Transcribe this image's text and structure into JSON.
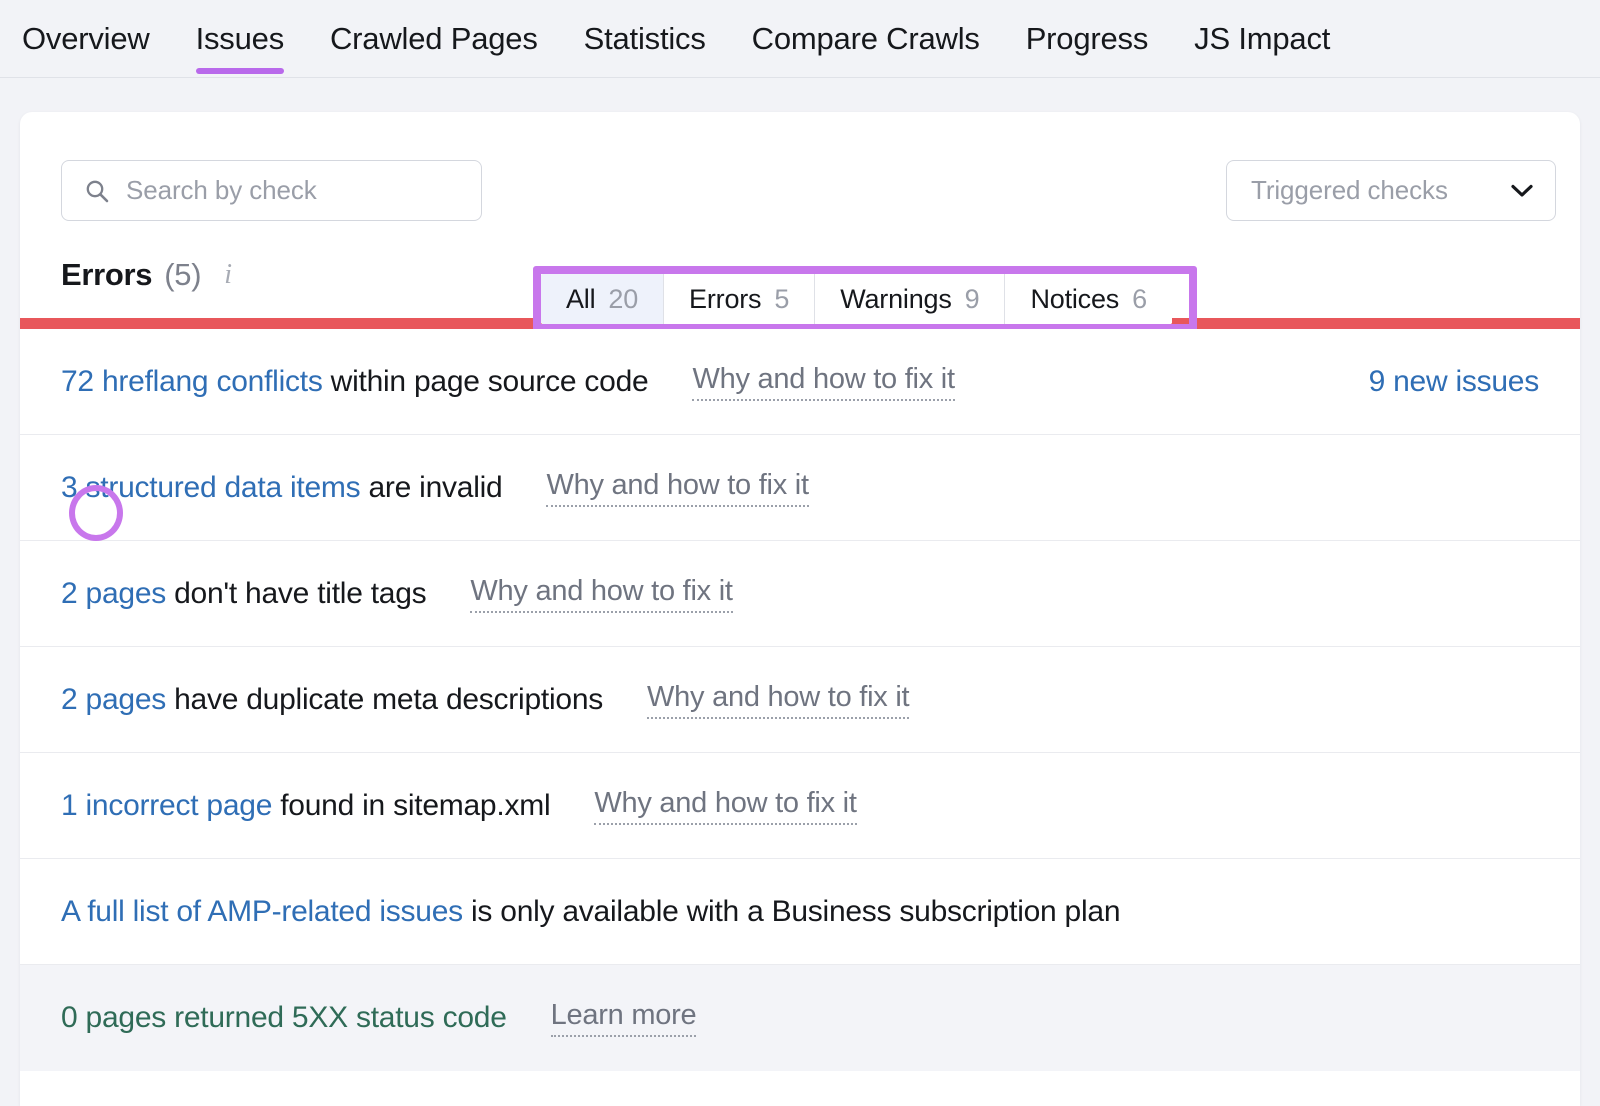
{
  "tabs": [
    {
      "label": "Overview",
      "active": false
    },
    {
      "label": "Issues",
      "active": true
    },
    {
      "label": "Crawled Pages",
      "active": false
    },
    {
      "label": "Statistics",
      "active": false
    },
    {
      "label": "Compare Crawls",
      "active": false
    },
    {
      "label": "Progress",
      "active": false
    },
    {
      "label": "JS Impact",
      "active": false
    }
  ],
  "toolbar": {
    "search_placeholder": "Search by check",
    "search_value": "",
    "segments": [
      {
        "label": "All",
        "count": "20",
        "selected": true
      },
      {
        "label": "Errors",
        "count": "5",
        "selected": false
      },
      {
        "label": "Warnings",
        "count": "9",
        "selected": false
      },
      {
        "label": "Notices",
        "count": "6",
        "selected": false
      }
    ],
    "dropdown_label": "Triggered checks"
  },
  "section": {
    "title": "Errors",
    "count": "(5)",
    "info_icon": "info-icon",
    "severity_color": "#e8575b"
  },
  "issues": [
    {
      "link_text": "72 hreflang conflicts",
      "rest_text": " within page source code",
      "fix_link": "Why and how to fix it",
      "new_issues": "9 new issues",
      "muted": false
    },
    {
      "link_text": "3 structured data items",
      "rest_text": " are invalid",
      "fix_link": "Why and how to fix it",
      "new_issues": "",
      "muted": false
    },
    {
      "link_text": "2 pages",
      "rest_text": " don't have title tags",
      "fix_link": "Why and how to fix it",
      "new_issues": "",
      "muted": false
    },
    {
      "link_text": "2 pages",
      "rest_text": " have duplicate meta descriptions",
      "fix_link": "Why and how to fix it",
      "new_issues": "",
      "muted": false
    },
    {
      "link_text": "1 incorrect page",
      "rest_text": " found in sitemap.xml",
      "fix_link": "Why and how to fix it",
      "new_issues": "",
      "muted": false
    },
    {
      "link_text": "A full list of AMP-related issues",
      "rest_text": " is only available with a Business subscription plan",
      "fix_link": "",
      "new_issues": "",
      "muted": false
    },
    {
      "link_text": "0 pages returned 5XX status code",
      "rest_text": "",
      "fix_link": "Learn more",
      "new_issues": "",
      "muted": true
    }
  ],
  "annotations": {
    "highlight_color": "#c877ec",
    "segment_box": "segmented-filter-highlight",
    "circle": "count-72-circle"
  }
}
